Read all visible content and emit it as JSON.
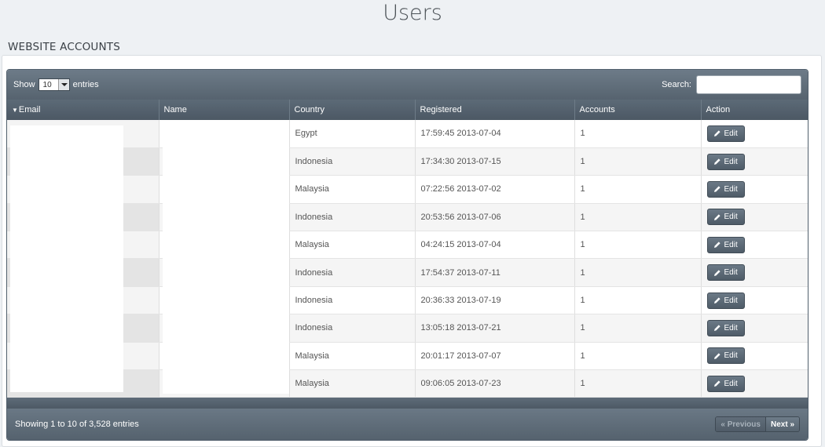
{
  "page": {
    "title": "Users",
    "section": "WEBSITE ACCOUNTS"
  },
  "toolbar": {
    "show_label": "Show",
    "entries_value": "10",
    "entries_label": "entries",
    "search_label": "Search:",
    "search_value": ""
  },
  "table": {
    "columns": [
      "Email",
      "Name",
      "Country",
      "Registered",
      "Accounts",
      "Action"
    ],
    "sort_indicator": "▼",
    "rows": [
      {
        "email": "",
        "name": "",
        "country": "Egypt",
        "registered": "17:59:45 2013-07-04",
        "accounts": "1",
        "action": "Edit"
      },
      {
        "email": "",
        "name": "",
        "country": "Indonesia",
        "registered": "17:34:30 2013-07-15",
        "accounts": "1",
        "action": "Edit"
      },
      {
        "email": "",
        "name": "",
        "country": "Malaysia",
        "registered": "07:22:56 2013-07-02",
        "accounts": "1",
        "action": "Edit"
      },
      {
        "email": "",
        "name": "",
        "country": "Indonesia",
        "registered": "20:53:56 2013-07-06",
        "accounts": "1",
        "action": "Edit"
      },
      {
        "email": "",
        "name": "",
        "country": "Malaysia",
        "registered": "04:24:15 2013-07-04",
        "accounts": "1",
        "action": "Edit"
      },
      {
        "email": "",
        "name": "",
        "country": "Indonesia",
        "registered": "17:54:37 2013-07-11",
        "accounts": "1",
        "action": "Edit"
      },
      {
        "email": "",
        "name": "",
        "country": "Indonesia",
        "registered": "20:36:33 2013-07-19",
        "accounts": "1",
        "action": "Edit"
      },
      {
        "email": "",
        "name": "",
        "country": "Indonesia",
        "registered": "13:05:18 2013-07-21",
        "accounts": "1",
        "action": "Edit"
      },
      {
        "email": "",
        "name": "",
        "country": "Malaysia",
        "registered": "20:01:17 2013-07-07",
        "accounts": "1",
        "action": "Edit"
      },
      {
        "email": "",
        "name": "",
        "country": "Malaysia",
        "registered": "09:06:05 2013-07-23",
        "accounts": "1",
        "action": "Edit"
      }
    ]
  },
  "footer": {
    "info": "Showing 1 to 10 of 3,528 entries",
    "prev_label": "Previous",
    "next_label": "Next",
    "prev_icon": "«",
    "next_icon": "»"
  },
  "colors": {
    "header_dark": "#4c5864",
    "header_light": "#6d7b88",
    "page_bg": "#eef1f4"
  }
}
